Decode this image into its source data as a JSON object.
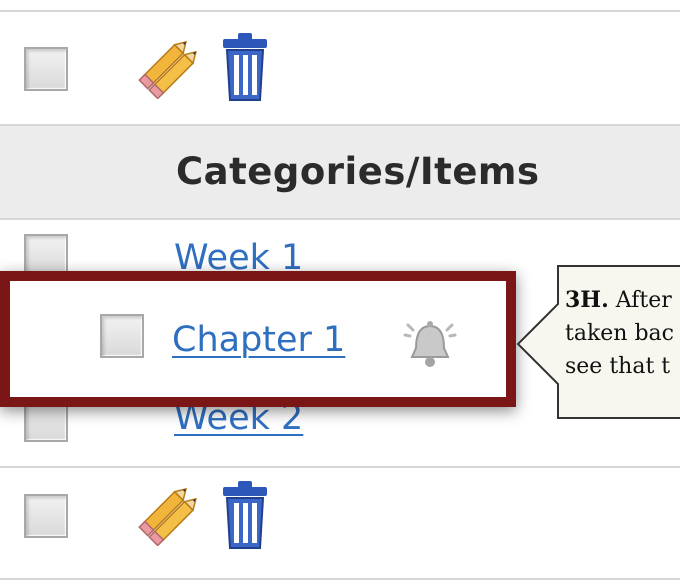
{
  "table": {
    "header": "Categories/Items",
    "rows": [
      {
        "label": "Week 1"
      },
      {
        "label": "Chapter 1"
      },
      {
        "label": "Week 2"
      }
    ]
  },
  "toolbar": {
    "edit_icon": "pencil-pair-icon",
    "delete_icon": "trash-can-icon"
  },
  "row_icons": {
    "alert_icon": "bell-icon"
  },
  "callout": {
    "step": "3H.",
    "line1": "After",
    "line2": "taken bac",
    "line3": "see that t"
  },
  "colors": {
    "link": "#2f6fc0",
    "highlight_border": "#7a1616",
    "header_background": "#ececec",
    "callout_background": "#f7f7ef"
  }
}
